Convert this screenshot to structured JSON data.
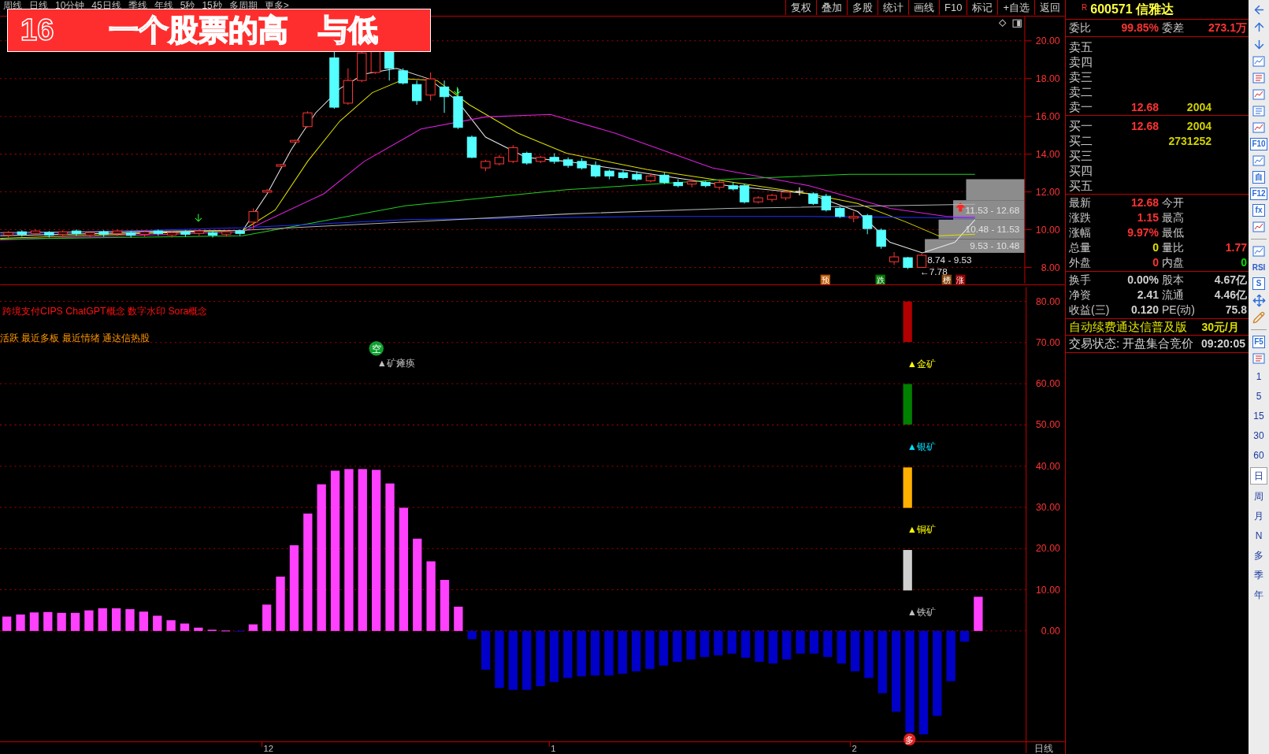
{
  "period_tabs": [
    "周线",
    "日线",
    "10分钟",
    "45日线",
    "季线",
    "年线",
    "5秒",
    "15秒",
    "多周期",
    "更多>"
  ],
  "toolbar": [
    "复权",
    "叠加",
    "多股",
    "统计",
    "画线",
    "F10",
    "标记",
    "+自选",
    "返回"
  ],
  "banner": {
    "number": "16",
    "title": "一个股票的高　与低"
  },
  "price_chart": {
    "axis_labels": [
      "20.00",
      "18.00",
      "16.00",
      "14.00",
      "12.00",
      "10.00",
      "8.00"
    ],
    "ranges": [
      {
        "label": "11.53 - 12.68",
        "boxed": true
      },
      {
        "label": "10.48 - 11.53",
        "boxed": true
      },
      {
        "label": "9.53 - 10.48",
        "boxed": true
      },
      {
        "label": "8.74 - 9.53",
        "boxed": false
      }
    ],
    "low_label": "←7.78",
    "markers": [
      {
        "text": "预",
        "color": "#c05a00"
      },
      {
        "text": "跌",
        "color": "#007a00"
      },
      {
        "text": "榜",
        "color": "#8a4a10"
      },
      {
        "text": "涨",
        "color": "#9a0000"
      }
    ]
  },
  "indicator": {
    "concepts": "跨境支付CIPS ChatGPT概念 数字水印 Sora概念",
    "tags": "活跃 最近多板 最近情绪 通达信热股",
    "signal_badge": "空",
    "signal_label": "▲矿瘫痪",
    "bottom_badge": "多",
    "mines": [
      {
        "kind": "gold",
        "label": "▲金矿",
        "color": "#b00000"
      },
      {
        "kind": "silver",
        "label": "▲银矿",
        "color": "#008000"
      },
      {
        "kind": "copper",
        "label": "▲铜矿",
        "color": "#ffb000"
      },
      {
        "kind": "iron",
        "label": "▲铁矿",
        "color": "#d0d0d0"
      }
    ],
    "period_label": "日线",
    "chart_data": {
      "type": "bar",
      "ylim": [
        -26.9,
        83.9
      ],
      "stacked": true,
      "grid": true,
      "categories": [
        null,
        null,
        null,
        null,
        null,
        null,
        null,
        null,
        null,
        null,
        null,
        null,
        null,
        null,
        null,
        null,
        null,
        null,
        null,
        "12",
        null,
        null,
        null,
        null,
        null,
        null,
        null,
        null,
        null,
        null,
        null,
        null,
        null,
        null,
        null,
        null,
        null,
        null,
        null,
        null,
        "1",
        null,
        null,
        null,
        null,
        null,
        null,
        null,
        null,
        null,
        null,
        null,
        null,
        null,
        null,
        null,
        null,
        null,
        null,
        null,
        null,
        null,
        "2",
        null,
        null,
        null,
        null,
        null,
        null,
        null,
        null,
        null,
        null,
        null,
        null
      ],
      "yticks": [
        {
          "value": 80,
          "label": "80.00"
        },
        {
          "value": 70,
          "label": "70.00"
        },
        {
          "value": 60,
          "label": "60.00"
        },
        {
          "value": 50,
          "label": "50.00"
        },
        {
          "value": 40,
          "label": "40.00"
        },
        {
          "value": 30,
          "label": "30.00"
        },
        {
          "value": 20,
          "label": "20.00"
        },
        {
          "value": 10,
          "label": "10.00"
        },
        {
          "value": 0,
          "label": "0.00"
        }
      ],
      "series": [
        {
          "color": "#ff40ff",
          "values": [
            3.5,
            4,
            4.5,
            4.6,
            4.4,
            4.4,
            5,
            5.5,
            5.5,
            5.3,
            4.7,
            3.7,
            2.6,
            1.8,
            0.8,
            0.3,
            0.1,
            null,
            1.6,
            6.4,
            13.2,
            20.8,
            28.5,
            35.6,
            38.9,
            39.3,
            39.3,
            39.1,
            35.8,
            29.9,
            22.4,
            16.9,
            12.4,
            5.9,
            null,
            null,
            null,
            null,
            null,
            null,
            null,
            null,
            null,
            null,
            null,
            null,
            null,
            null,
            null,
            null,
            null,
            null,
            null,
            null,
            null,
            null,
            null,
            null,
            null,
            null,
            null,
            null,
            null,
            null,
            null,
            null,
            null,
            null,
            null,
            null,
            null,
            8.3,
            null,
            null,
            null
          ]
        },
        {
          "color": "#0000c8",
          "values": [
            null,
            null,
            null,
            null,
            null,
            null,
            null,
            null,
            null,
            null,
            null,
            null,
            null,
            null,
            null,
            null,
            null,
            -0.2,
            null,
            null,
            null,
            null,
            null,
            null,
            null,
            null,
            null,
            null,
            null,
            null,
            null,
            null,
            null,
            null,
            -2,
            -9.4,
            -13.8,
            -14.3,
            -14.3,
            -13.4,
            -12.4,
            -11.4,
            -11,
            -10.8,
            -10.8,
            -10.4,
            -9.8,
            -9.2,
            -8.4,
            -7.5,
            -6.9,
            -6.3,
            -5.9,
            -5.5,
            -6.5,
            -7.5,
            -7.9,
            -6.9,
            -5.5,
            -5.5,
            -6.3,
            -7.9,
            -9.8,
            -11.4,
            -15.1,
            -19.6,
            -24.6,
            -25.1,
            -20.6,
            -12.2,
            -2.6,
            null,
            null,
            null,
            null
          ]
        }
      ]
    }
  },
  "quote": {
    "badge": "R",
    "code": "600571",
    "name": "信雅达",
    "ratio": [
      {
        "label": "委比",
        "value": "99.85%"
      },
      {
        "label": "委差",
        "value": "273.1万"
      }
    ],
    "asks": [
      {
        "label": "卖五"
      },
      {
        "label": "卖四"
      },
      {
        "label": "卖三"
      },
      {
        "label": "卖二"
      },
      {
        "label": "卖一",
        "price": "12.68",
        "volume": "2004"
      }
    ],
    "bids": [
      {
        "label": "买一",
        "price": "12.68",
        "volume": "2004"
      },
      {
        "label": "买二",
        "volume": "2731252"
      },
      {
        "label": "买三"
      },
      {
        "label": "买四"
      },
      {
        "label": "买五"
      }
    ],
    "stats": [
      [
        {
          "label": "最新",
          "value": "12.68",
          "color": "#ff3232"
        },
        {
          "label": "今开"
        }
      ],
      [
        {
          "label": "涨跌",
          "value": "1.15",
          "color": "#ff3232"
        },
        {
          "label": "最高"
        }
      ],
      [
        {
          "label": "涨幅",
          "value": "9.97%",
          "color": "#ff3232"
        },
        {
          "label": "最低"
        }
      ],
      [
        {
          "label": "总量",
          "value": "0",
          "color": "#e0e000"
        },
        {
          "label": "量比",
          "value": "1.77",
          "color": "#ff3232"
        }
      ],
      [
        {
          "label": "外盘",
          "value": "0",
          "color": "#ff3232"
        },
        {
          "label": "内盘",
          "value": "0",
          "color": "#00e000"
        }
      ]
    ],
    "finance": [
      [
        {
          "label": "换手",
          "value": "0.00%",
          "color": "#d0d0d0"
        },
        {
          "label": "股本",
          "value": "4.67亿",
          "color": "#d0d0d0"
        }
      ],
      [
        {
          "label": "净资",
          "value": "2.41",
          "color": "#d0d0d0"
        },
        {
          "label": "流通",
          "value": "4.46亿",
          "color": "#d0d0d0"
        }
      ],
      [
        {
          "label": "收益(三)",
          "value": "0.120",
          "color": "#d0d0d0"
        },
        {
          "label": "PE(动)",
          "value": "75.8",
          "color": "#d0d0d0"
        }
      ]
    ],
    "ad": {
      "text": "自动续费通达信普及版",
      "price": "30元/月"
    },
    "status": {
      "text": "交易状态: 开盘集合竞价",
      "time": "09:20:05"
    }
  },
  "side_bar": [
    {
      "kind": "back"
    },
    {
      "kind": "up"
    },
    {
      "kind": "down"
    },
    {
      "kind": "tool"
    },
    {
      "kind": "tool"
    },
    {
      "kind": "tool"
    },
    {
      "kind": "tool"
    },
    {
      "kind": "tool"
    },
    {
      "kind": "badge",
      "text": "F10"
    },
    {
      "kind": "tool"
    },
    {
      "kind": "badge",
      "text": "自"
    },
    {
      "kind": "badge",
      "text": "F12"
    },
    {
      "kind": "badge",
      "text": "fx"
    },
    {
      "kind": "tool"
    },
    {
      "kind": "divider"
    },
    {
      "kind": "tool"
    },
    {
      "kind": "plain",
      "text": "RSI"
    },
    {
      "kind": "badge",
      "text": "S"
    },
    {
      "kind": "move"
    },
    {
      "kind": "pencil"
    },
    {
      "kind": "divider"
    },
    {
      "kind": "badge",
      "text": "F5"
    },
    {
      "kind": "tool"
    },
    {
      "kind": "period",
      "text": "1",
      "selected": false
    },
    {
      "kind": "period",
      "text": "5",
      "selected": false
    },
    {
      "kind": "period",
      "text": "15",
      "selected": false
    },
    {
      "kind": "period",
      "text": "30",
      "selected": false
    },
    {
      "kind": "period",
      "text": "60",
      "selected": false
    },
    {
      "kind": "period",
      "text": "日",
      "selected": true
    },
    {
      "kind": "period",
      "text": "周",
      "selected": false
    },
    {
      "kind": "period",
      "text": "月",
      "selected": false
    },
    {
      "kind": "period",
      "text": "N",
      "selected": false
    },
    {
      "kind": "period",
      "text": "多",
      "selected": false
    },
    {
      "kind": "period",
      "text": "季",
      "selected": false
    },
    {
      "kind": "period",
      "text": "年",
      "selected": false
    }
  ]
}
